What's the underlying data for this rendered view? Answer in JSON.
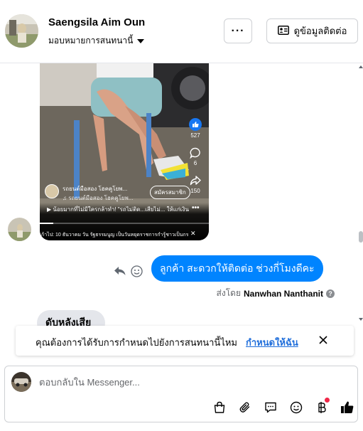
{
  "header": {
    "name": "Saengsila Aim Oun",
    "assign_label": "มอบหมายการสนทนานี้",
    "more_label": "···",
    "contact_label": "ดูข้อมูลติดต่อ"
  },
  "video": {
    "like_count": "527",
    "comment_count": "6",
    "share_count": "150",
    "channel_title": "รถยนต์มือสอง โฮคคูโยพ...",
    "channel_sub": "♫ รถยนต์มือสอง โฮคคูโยพ...",
    "subscribe_label": "สมัครสมาชิก",
    "caption": "▶ น้อยมากที่ไม่มีใครกล้าทำ! \"รถไม่ติด...เสียไม่... ให้แก่เงิน",
    "ticker": "ก้าไป: 10 ธันวาคม วัน รัฐธรรมนูญ เป็นวันหยุดราชการกำรู้ชาวเป็นกร...",
    "close_glyph": "✕",
    "dots_glyph": "•••"
  },
  "messages": {
    "outgoing_text": "ลูกค้า สะดวกให้ติดต่อ ช่วงกี่โมงดีคะ",
    "sent_by_prefix": "ส่งโดย",
    "sent_by_name": "Nanwhan Nanthanit",
    "info_glyph": "?",
    "incoming_text": "ดับหลังเสีย"
  },
  "banner": {
    "text": "คุณต้องการได้รับการกำหนดไปยังการสนทนานี้ไหม",
    "link": "กำหนดให้ฉัน"
  },
  "composer": {
    "placeholder": "ตอบกลับใน Messenger..."
  },
  "colors": {
    "accent": "#0084ff",
    "link": "#216fdb",
    "incoming_bubble": "#e4e6eb"
  }
}
